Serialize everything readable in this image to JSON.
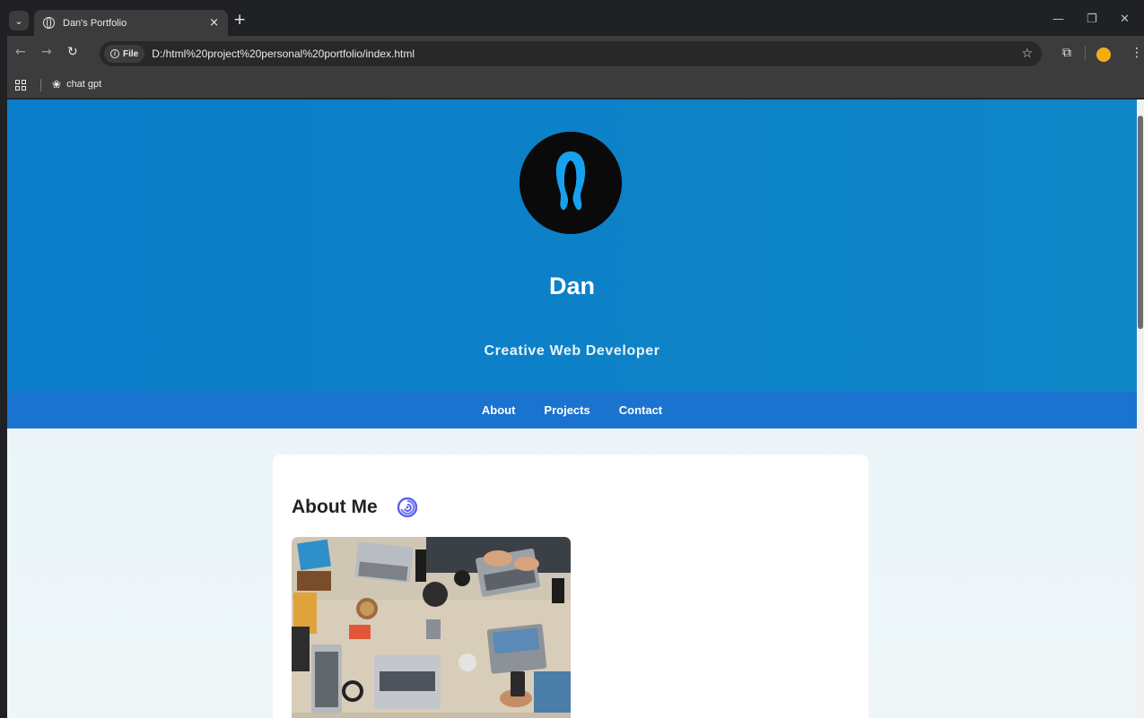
{
  "browser": {
    "tab_title": "Dan's Portfolio",
    "tab_close": "×",
    "new_tab": "+",
    "site_chip": "File",
    "url": "D:/html%20project%20personal%20portfolio/index.html",
    "bookmark_label": "chat gpt",
    "icons": {
      "tab_search": "chevron-down-icon",
      "favicon": "globe-icon",
      "back": "arrow-left-icon",
      "forward": "arrow-right-icon",
      "reload": "reload-icon",
      "info": "info-icon",
      "bookmark_star": "star-icon",
      "extensions": "puzzle-icon",
      "profile": "avatar-icon",
      "menu": "kebab-icon",
      "apps": "apps-grid-icon",
      "bookmark": "chatgpt-icon"
    }
  },
  "page": {
    "hero": {
      "name": "Dan",
      "role": "Creative Web Developer"
    },
    "nav": {
      "items": [
        {
          "label": "About"
        },
        {
          "label": "Projects"
        },
        {
          "label": "Contact"
        }
      ]
    },
    "about": {
      "title": "About Me",
      "icon": "cyclone-icon"
    },
    "colors": {
      "hero": "#0b7cc9",
      "navbar": "#1a73cf",
      "page_bg": "#e8f3f8",
      "card": "#ffffff",
      "accent_icon": "#5b5ff0",
      "avatar_glow": "#1aa7ff"
    }
  }
}
